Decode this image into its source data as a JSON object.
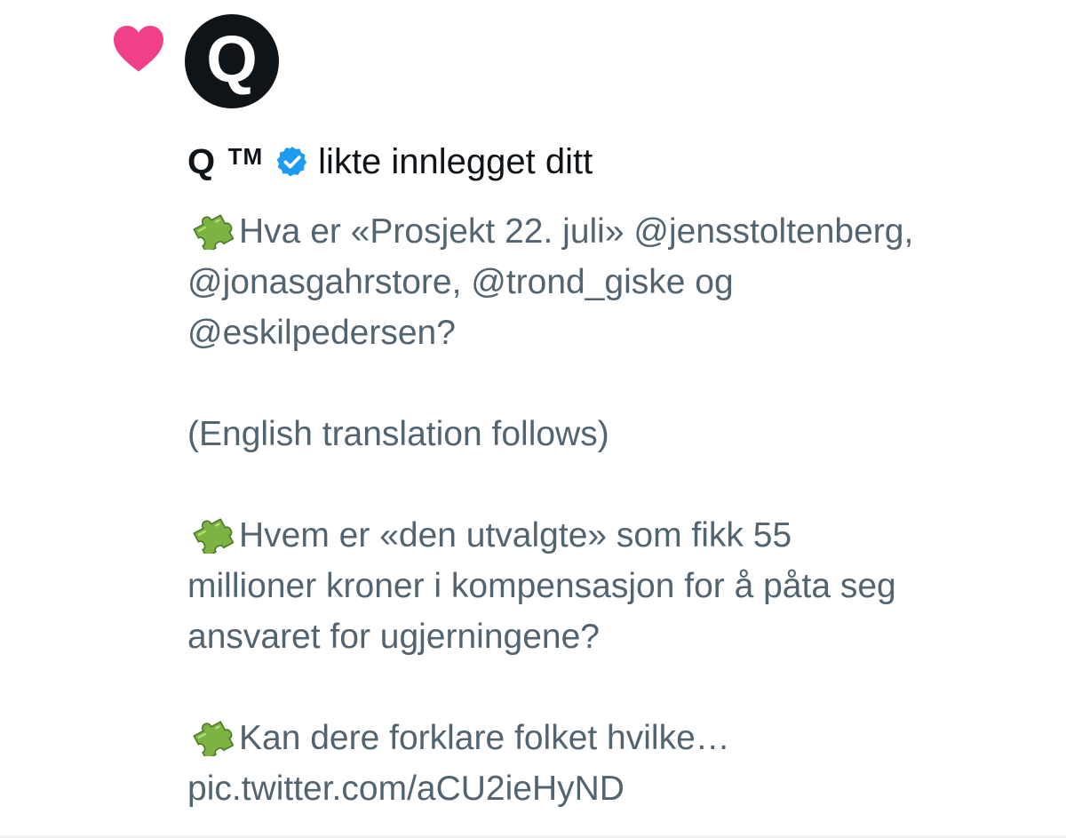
{
  "notification": {
    "type_icon": "heart-icon",
    "avatar": {
      "letter": "Q",
      "background": "#0f1419"
    },
    "user": {
      "name": "Q",
      "suffix": "TM",
      "verified_icon": "verified-badge-icon"
    },
    "action_text": "likte innlegget ditt"
  },
  "tweet": {
    "bullet_icon": "puzzle-piece-icon",
    "lines": [
      "Hva er «Prosjekt 22. juli» @jensstoltenberg,",
      "@jonasgahrstore, @trond_giske og",
      "@eskilpedersen?",
      "",
      "(English translation follows)",
      "",
      "Hvem er «den utvalgte» som fikk 55",
      "millioner kroner i kompensasjon for å påta seg",
      "ansvaret for ugjerningene?",
      "",
      "Kan dere forklare folket hvilke…",
      "pic.twitter.com/aCU2ieHyND"
    ]
  },
  "colors": {
    "heart": "#f0408a",
    "verified": "#1d9bf0",
    "primary_text": "#0f1419",
    "secondary_text": "#536471",
    "divider": "#eff3f4"
  }
}
